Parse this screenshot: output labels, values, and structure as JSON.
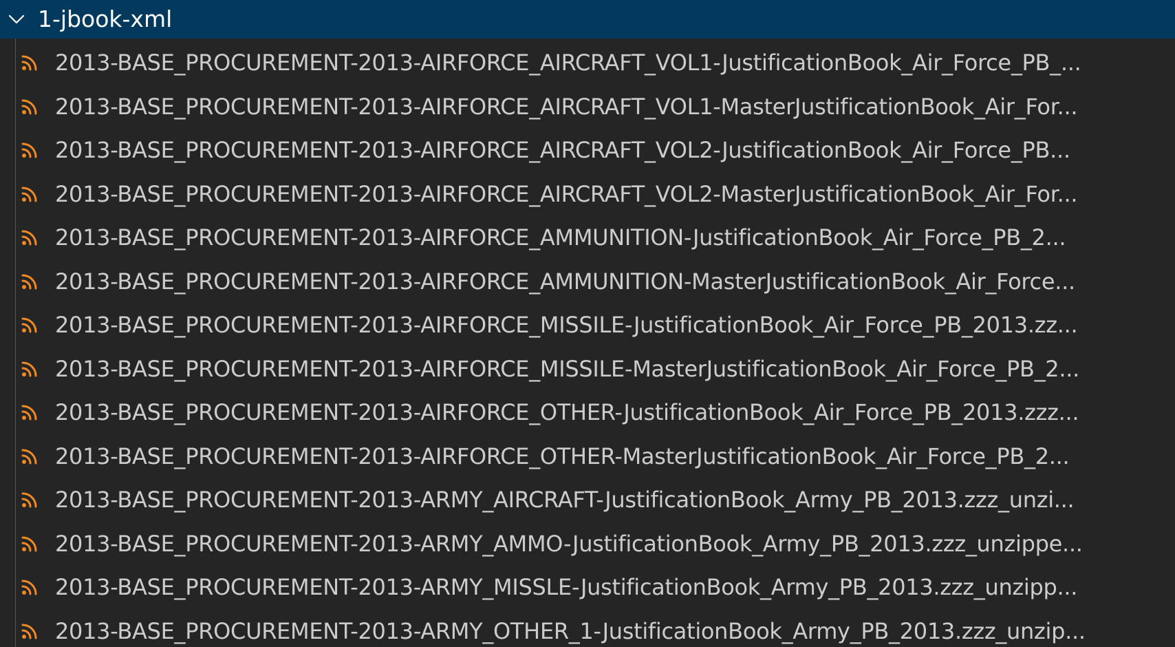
{
  "colors": {
    "background": "#252526",
    "selected_header": "#04395e",
    "text": "#cccccc",
    "header_text": "#ffffff",
    "feed_icon": "#f08a24"
  },
  "folder": {
    "name": "1-jbook-xml",
    "expanded_icon": "chevron-down-icon"
  },
  "files": [
    {
      "name": "2013-BASE_PROCUREMENT-2013-AIRFORCE_AIRCRAFT_VOL1-JustificationBook_Air_Force_PB_...",
      "icon": "rss-feed-icon"
    },
    {
      "name": "2013-BASE_PROCUREMENT-2013-AIRFORCE_AIRCRAFT_VOL1-MasterJustificationBook_Air_For...",
      "icon": "rss-feed-icon"
    },
    {
      "name": "2013-BASE_PROCUREMENT-2013-AIRFORCE_AIRCRAFT_VOL2-JustificationBook_Air_Force_PB...",
      "icon": "rss-feed-icon"
    },
    {
      "name": "2013-BASE_PROCUREMENT-2013-AIRFORCE_AIRCRAFT_VOL2-MasterJustificationBook_Air_For...",
      "icon": "rss-feed-icon"
    },
    {
      "name": "2013-BASE_PROCUREMENT-2013-AIRFORCE_AMMUNITION-JustificationBook_Air_Force_PB_2...",
      "icon": "rss-feed-icon"
    },
    {
      "name": "2013-BASE_PROCUREMENT-2013-AIRFORCE_AMMUNITION-MasterJustificationBook_Air_Force...",
      "icon": "rss-feed-icon"
    },
    {
      "name": "2013-BASE_PROCUREMENT-2013-AIRFORCE_MISSILE-JustificationBook_Air_Force_PB_2013.zz...",
      "icon": "rss-feed-icon"
    },
    {
      "name": "2013-BASE_PROCUREMENT-2013-AIRFORCE_MISSILE-MasterJustificationBook_Air_Force_PB_2...",
      "icon": "rss-feed-icon"
    },
    {
      "name": "2013-BASE_PROCUREMENT-2013-AIRFORCE_OTHER-JustificationBook_Air_Force_PB_2013.zzz...",
      "icon": "rss-feed-icon"
    },
    {
      "name": "2013-BASE_PROCUREMENT-2013-AIRFORCE_OTHER-MasterJustificationBook_Air_Force_PB_2...",
      "icon": "rss-feed-icon"
    },
    {
      "name": "2013-BASE_PROCUREMENT-2013-ARMY_AIRCRAFT-JustificationBook_Army_PB_2013.zzz_unzi...",
      "icon": "rss-feed-icon"
    },
    {
      "name": "2013-BASE_PROCUREMENT-2013-ARMY_AMMO-JustificationBook_Army_PB_2013.zzz_unzippe...",
      "icon": "rss-feed-icon"
    },
    {
      "name": "2013-BASE_PROCUREMENT-2013-ARMY_MISSLE-JustificationBook_Army_PB_2013.zzz_unzipp...",
      "icon": "rss-feed-icon"
    },
    {
      "name": "2013-BASE_PROCUREMENT-2013-ARMY_OTHER_1-JustificationBook_Army_PB_2013.zzz_unzip...",
      "icon": "rss-feed-icon"
    }
  ]
}
